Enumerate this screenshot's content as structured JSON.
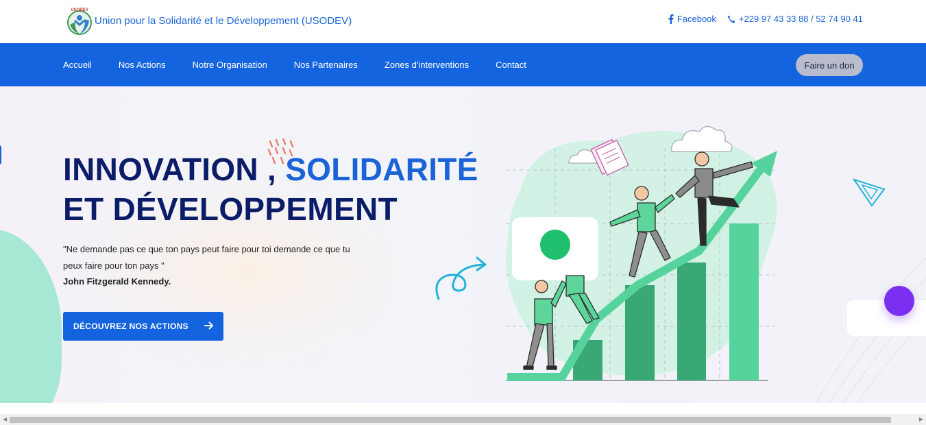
{
  "header": {
    "brand": "Union pour la Solidarité et le Développement (USODEV)",
    "logo_text": "USODEV",
    "facebook_label": "Facebook",
    "phone": "+229 97 43 33 88 / 52 74 90 41"
  },
  "nav": {
    "items": [
      {
        "label": "Accueil"
      },
      {
        "label": "Nos Actions"
      },
      {
        "label": "Notre Organisation"
      },
      {
        "label": "Nos Partenaires"
      },
      {
        "label": "Zones d'interventions"
      },
      {
        "label": "Contact"
      }
    ],
    "donate_label": "Faire un don"
  },
  "hero": {
    "title_part1": "INNOVATION , ",
    "title_accent": "SOLIDARITÉ",
    "title_line2": "ET DÉVELOPPEMENT",
    "quote": "\"Ne demande pas ce que ton pays peut faire pour toi demande ce que tu peux faire pour ton pays \"",
    "author": "John Fitzgerald Kennedy.",
    "cta_label": "DÉCOUVREZ NOS ACTIONS"
  },
  "colors": {
    "primary": "#1463df",
    "title": "#0b1c68",
    "accent_green": "#4fd39a",
    "purple": "#7b2ff0"
  },
  "icons": [
    "facebook-icon",
    "phone-icon",
    "arrow-right-icon",
    "logo-icon"
  ]
}
